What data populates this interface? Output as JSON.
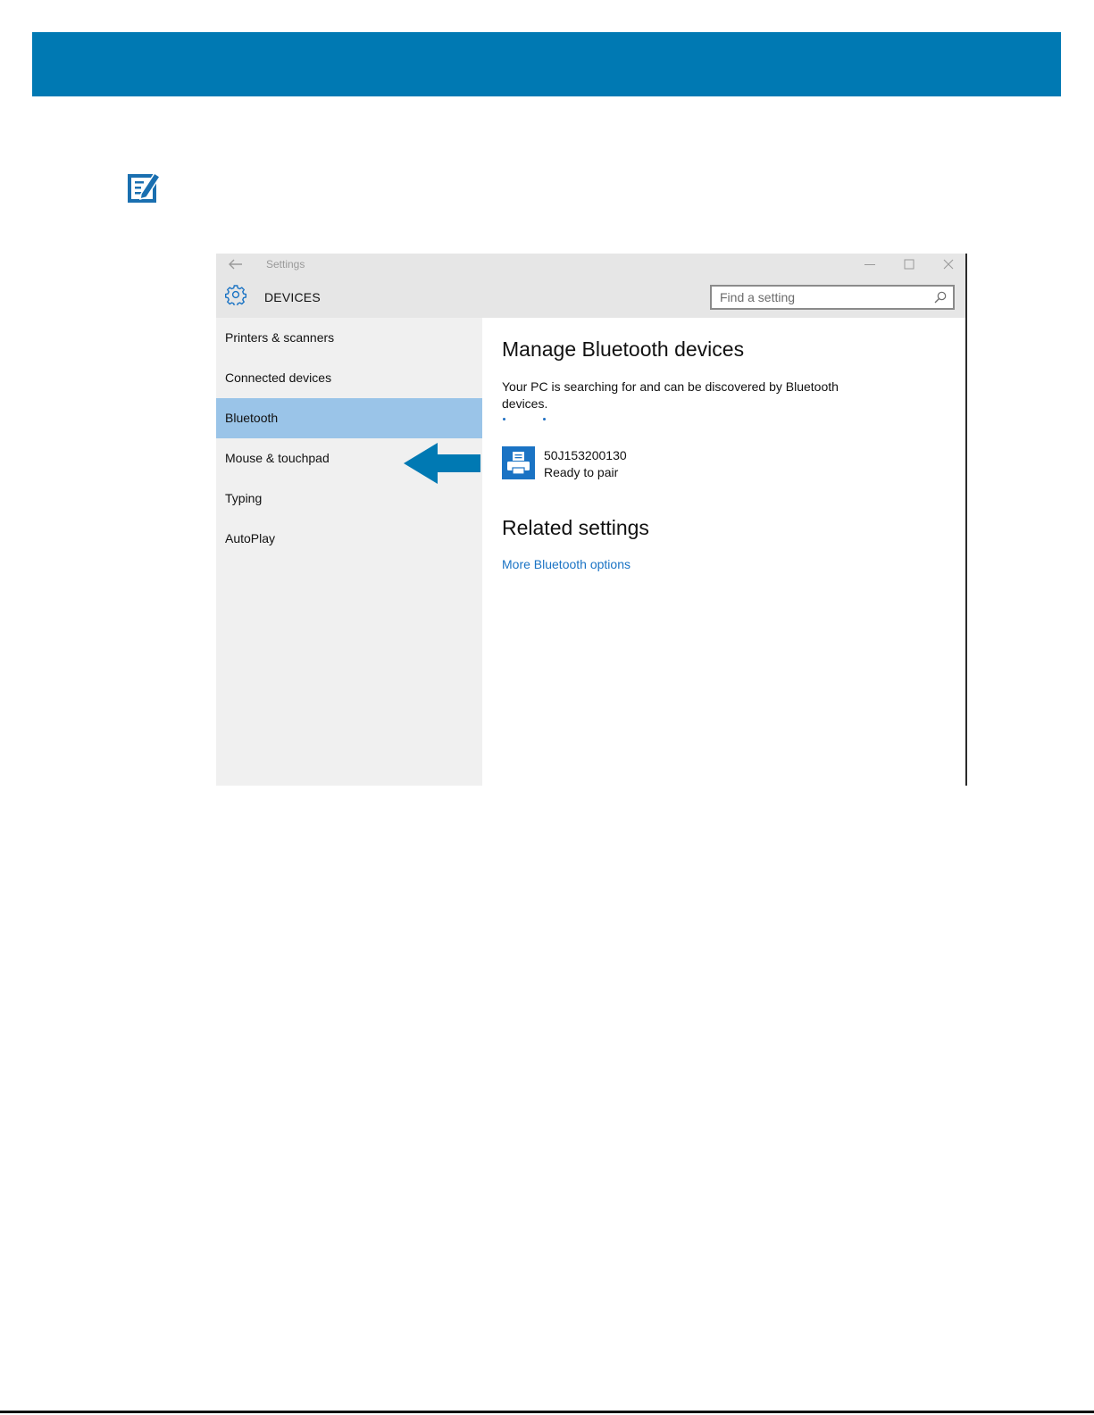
{
  "colors": {
    "banner": "#0079b3",
    "accent": "#1a73c4",
    "sidebar_bg": "#f0f0f0",
    "sidebar_active": "#9ac4e8",
    "header_bg": "#e6e6e6"
  },
  "window": {
    "title": "Settings",
    "section_title": "DEVICES",
    "icons": {
      "back": "back-arrow-icon",
      "section": "gear-icon",
      "minimize": "minimize-icon",
      "maximize": "maximize-icon",
      "close": "close-icon"
    }
  },
  "search": {
    "placeholder": "Find a setting",
    "value": "",
    "icon": "search-icon"
  },
  "sidebar": {
    "items": [
      {
        "label": "Printers & scanners",
        "active": false
      },
      {
        "label": "Connected devices",
        "active": false
      },
      {
        "label": "Bluetooth",
        "active": true
      },
      {
        "label": "Mouse & touchpad",
        "active": false
      },
      {
        "label": "Typing",
        "active": false
      },
      {
        "label": "AutoPlay",
        "active": false
      }
    ]
  },
  "main": {
    "title": "Manage Bluetooth devices",
    "status": "Your PC is searching for and can be discovered by Bluetooth devices.",
    "devices": [
      {
        "name": "50J153200130",
        "status": "Ready to pair",
        "icon": "printer-icon"
      }
    ],
    "related_title": "Related settings",
    "related_links": [
      {
        "label": "More Bluetooth options"
      }
    ]
  },
  "annotations": {
    "note_icon": "note-edit-icon",
    "arrow": "arrow-left-icon"
  }
}
